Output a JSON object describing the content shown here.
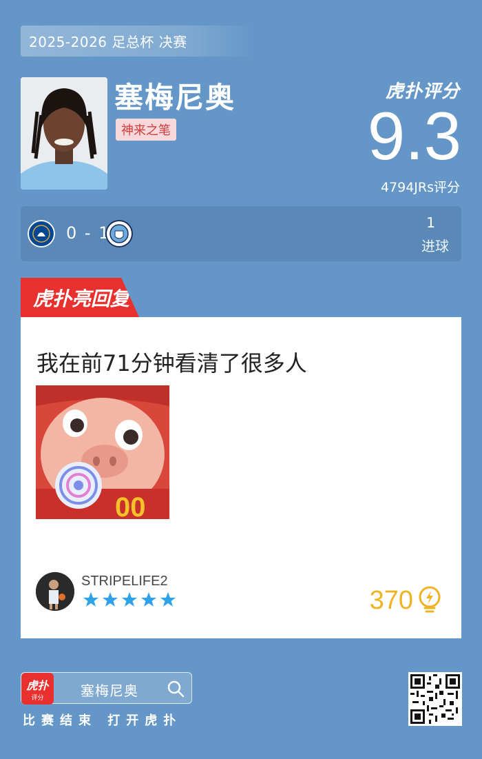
{
  "competition": "2025-2026 足总杯 决赛",
  "player": {
    "name": "塞梅尼奥",
    "tag": "神来之笔"
  },
  "brand": {
    "logo_text": "虎扑评分",
    "reply_logo": "虎扑亮回复",
    "app_icon_text": "虎扑",
    "app_icon_sub": "评分"
  },
  "rating": {
    "score": "9.3",
    "count_label": "4794JRs评分"
  },
  "match": {
    "home_badge": "chelsea-badge",
    "away_badge": "manchester-city-badge",
    "score": "0 - 1",
    "goals_value": "1",
    "goals_label": "进球"
  },
  "reply": {
    "text": "我在前71分钟看清了很多人",
    "image": "cartoon-pig-with-lollipop",
    "username": "STRIPELIFE2",
    "stars": 5,
    "likes": "370"
  },
  "footer": {
    "search_text": "塞梅尼奥",
    "caption": "比赛结束 打开虎扑"
  },
  "colors": {
    "background": "#6497c8",
    "accent_red": "#e8302f",
    "likes_gold": "#f0b323",
    "star_blue": "#2ea1e8"
  }
}
